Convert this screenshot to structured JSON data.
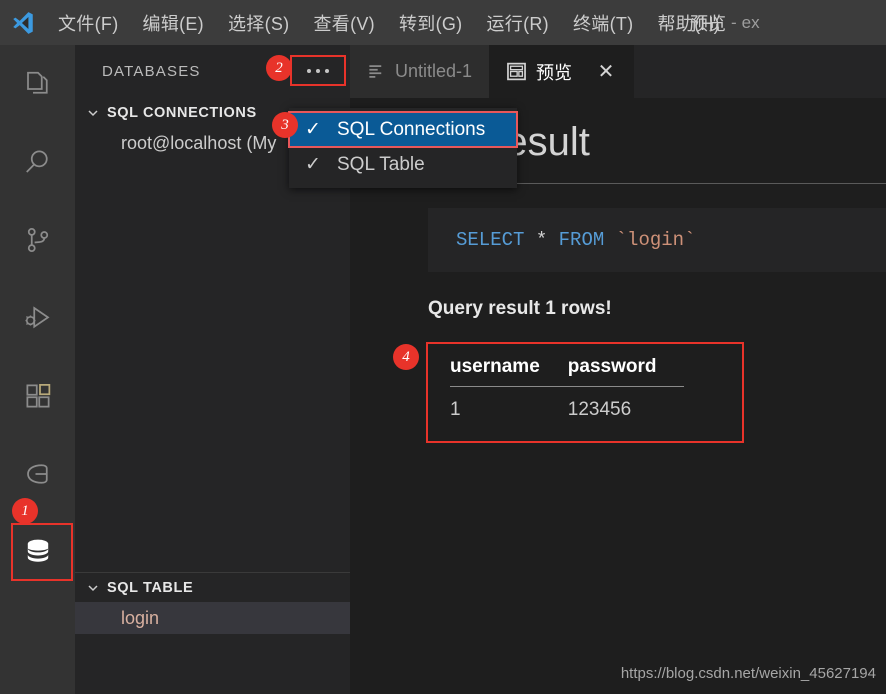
{
  "window": {
    "title_main": "预览",
    "title_sep": "-",
    "title_sub": "ex"
  },
  "menubar": {
    "logo_icon": "vscode-logo-icon",
    "items": [
      {
        "label": "文件(F)"
      },
      {
        "label": "编辑(E)"
      },
      {
        "label": "选择(S)"
      },
      {
        "label": "查看(V)"
      },
      {
        "label": "转到(G)"
      },
      {
        "label": "运行(R)"
      },
      {
        "label": "终端(T)"
      },
      {
        "label": "帮助(H)"
      }
    ]
  },
  "activitybar": {
    "items": [
      {
        "name": "explorer",
        "icon": "files-icon",
        "active": false
      },
      {
        "name": "search",
        "icon": "search-icon",
        "active": false
      },
      {
        "name": "source-control",
        "icon": "source-control-icon",
        "active": false
      },
      {
        "name": "run-and-debug",
        "icon": "run-debug-icon",
        "active": false
      },
      {
        "name": "extensions",
        "icon": "extensions-icon",
        "active": false
      },
      {
        "name": "remote-explorer",
        "icon": "remote-explorer-icon",
        "active": false
      },
      {
        "name": "database",
        "icon": "database-icon",
        "active": true
      }
    ]
  },
  "sidebar": {
    "title": "DATABASES",
    "more_actions_icon": "ellipsis-icon",
    "sections": [
      {
        "label": "SQL CONNECTIONS",
        "expanded": true,
        "chevron_icon": "chevron-down-icon",
        "items": [
          {
            "label": "root@localhost (My",
            "selected": false
          }
        ]
      },
      {
        "label": "SQL TABLE",
        "expanded": true,
        "chevron_icon": "chevron-down-icon",
        "items": [
          {
            "label": "login",
            "selected": true
          }
        ]
      }
    ]
  },
  "dropdown": {
    "visible": true,
    "items": [
      {
        "label": "SQL Connections",
        "checked": true,
        "checkmark": "✓",
        "selected": true
      },
      {
        "label": "SQL Table",
        "checked": true,
        "checkmark": "✓",
        "selected": false
      }
    ]
  },
  "tabs": [
    {
      "label": "Untitled-1",
      "icon": "text-file-icon",
      "active": false,
      "closable": false
    },
    {
      "label": "预览",
      "icon": "preview-layout-icon",
      "active": true,
      "closable": true,
      "close_glyph": "✕"
    }
  ],
  "editor": {
    "heading": "Query result",
    "code": {
      "keyword1": "SELECT",
      "star": " * ",
      "keyword2": "FROM",
      "space": " ",
      "identifier": "`login`"
    },
    "result_label": "Query result 1 rows!",
    "table": {
      "columns": [
        "username",
        "password"
      ],
      "rows": [
        [
          "1",
          "123456"
        ]
      ]
    }
  },
  "watermark": "https://blog.csdn.net/weixin_45627194",
  "annotations": [
    {
      "number": "1",
      "target": "database-activity-icon"
    },
    {
      "number": "2",
      "target": "more-actions-button"
    },
    {
      "number": "3",
      "target": "dropdown-sql-connections"
    },
    {
      "number": "4",
      "target": "result-table"
    }
  ],
  "colors": {
    "accent_red": "#e8332a",
    "menu_bar_bg": "#3c3c3c",
    "activity_bar_bg": "#333333",
    "sidebar_bg": "#252526",
    "editor_bg": "#1e1e1e",
    "selection_blue": "#0a5a96",
    "sql_keyword": "#569cd6",
    "sql_string": "#ce9178"
  }
}
